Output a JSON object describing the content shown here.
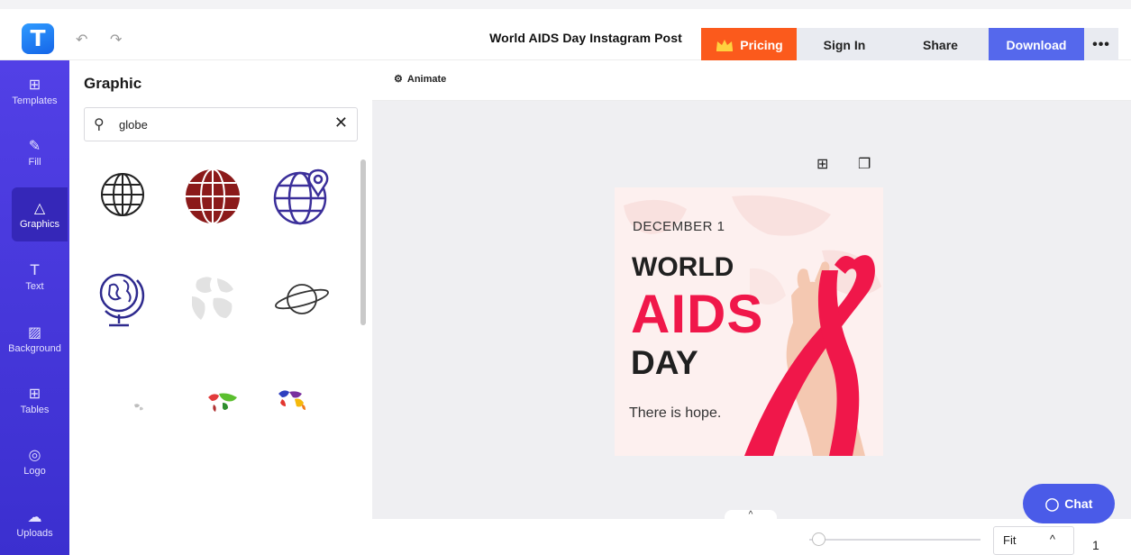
{
  "app": {
    "logo_letter": "T",
    "brand_color": "#4f3fe5"
  },
  "history": {
    "undo_icon": "undo-icon",
    "redo_icon": "redo-icon",
    "undo_glyph": "↶",
    "redo_glyph": "↷"
  },
  "header": {
    "doc_title": "World AIDS Day Instagram Post",
    "pricing_label": "Pricing",
    "signin_label": "Sign In",
    "share_label": "Share",
    "download_label": "Download",
    "more_label": "•••",
    "pricing_color": "#fb5a1c",
    "download_color": "#5568ec"
  },
  "sidebar": {
    "items": [
      {
        "label": "Templates",
        "icon": "templates-icon",
        "glyph": "⊞"
      },
      {
        "label": "Fill",
        "icon": "pencil-icon",
        "glyph": "✎"
      },
      {
        "label": "Graphics",
        "icon": "shapes-icon",
        "glyph": "△"
      },
      {
        "label": "Text",
        "icon": "text-icon",
        "glyph": "T"
      },
      {
        "label": "Background",
        "icon": "background-icon",
        "glyph": "▨"
      },
      {
        "label": "Tables",
        "icon": "table-icon",
        "glyph": "⊞"
      },
      {
        "label": "Logo",
        "icon": "logo-icon",
        "glyph": "◎"
      },
      {
        "label": "Uploads",
        "icon": "upload-cloud-icon",
        "glyph": "☁"
      }
    ],
    "active": "Graphics"
  },
  "panel": {
    "title": "Graphic",
    "search_value": "globe",
    "search_icon": "search-icon",
    "clear_icon": "close-icon",
    "search_glyph": "⚲",
    "clear_glyph": "✕",
    "graphics": [
      "globe-outline-icon",
      "globe-dark-red-icon",
      "globe-location-pin-icon",
      "desk-globe-icon",
      "world-map-globe-gray-icon",
      "planet-ring-icon",
      "world-map-small-gray-icon",
      "world-map-colored-icon",
      "world-map-multicolor-icon"
    ]
  },
  "toolbar": {
    "animate_label": "Animate",
    "animate_icon": "animate-icon",
    "animate_glyph": "⚙"
  },
  "canvas": {
    "add_page_icon": "add-page-icon",
    "duplicate_icon": "duplicate-icon",
    "add_glyph": "⊞",
    "dup_glyph": "❐",
    "poster": {
      "date": "DECEMBER 1",
      "line1": "WORLD",
      "line2": "AIDS",
      "line3": "DAY",
      "tagline": "There is hope.",
      "accent_color": "#f0174a",
      "background_color": "#fdf0ef"
    }
  },
  "bottom": {
    "chat_label": "Chat",
    "chat_glyph": "◯",
    "zoom_mode": "Fit",
    "zoom_chev": "^",
    "page_count": "1",
    "collapse_glyph": "‹",
    "page_up_glyph": "^",
    "zoom_level": 0.05
  }
}
